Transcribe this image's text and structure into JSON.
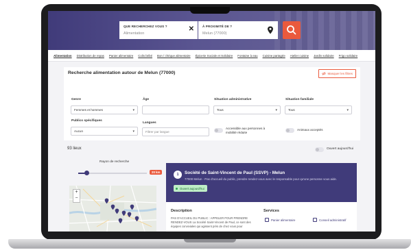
{
  "search": {
    "what_label": "QUE RECHERCHEZ VOUS ?",
    "what_value": "Alimentation",
    "where_label": "À PROXIMITÉ DE ?",
    "where_value": "Melun (77000)"
  },
  "categories": [
    "Alimentation",
    "Distribution de repas",
    "Panier alimentaire",
    "Colis bébé",
    "Bon / chèque alimentaire",
    "Épicerie Sociale et Solidaire",
    "Fontaine à eau",
    "Cuisine partagée",
    "Atelier cuisine",
    "Jardin solidaire",
    "Frigo solidaire"
  ],
  "filters": {
    "title": "Recherche alimentation autour de Melun (77000)",
    "hide_label": "Masquer les filtres",
    "genre_label": "Genre",
    "genre_value": "Femmes et hommes",
    "age_label": "Âge",
    "situation_admin_label": "Situation administrative",
    "situation_admin_value": "Tous",
    "situation_familiale_label": "Situation familiale",
    "situation_familiale_value": "Tous",
    "publics_label": "Publics spécifiques",
    "publics_value": "Aucun",
    "langues_label": "Langues",
    "langues_placeholder": "Filtrer par langue",
    "accessible_label_1": "Accessible aux personnes à",
    "accessible_label_2": "mobilité réduite",
    "animaux_label": "Animaux acceptés"
  },
  "results": {
    "count": "93 lieux",
    "open_today_label": "Ouvert aujourd'hui",
    "radius_label": "Rayon de recherche",
    "radius_value": "20 km"
  },
  "card": {
    "number": "1",
    "title": "Société de Saint-Vincent de Paul (SSVP) - Melun",
    "subtitle": "77000 Melun · Pas d'accueil du public, prendre rendez-vous avec le responsable pour qu'une personne vous aide.",
    "open_badge": "Ouvert aujourd'hui",
    "description_title": "Description",
    "description_lines": [
      "PAS D'ACCUEIL DU PUBLIC : APPELER POUR PRENDRE",
      "RENDEZ-VOUS La Société Saint-Vincent de Paul, ce sont des",
      "équipes conviviales qui agissent près de chez vous pour"
    ],
    "services_title": "Services",
    "services": [
      "Panier alimentaire",
      "Conseil administratif"
    ]
  },
  "colors": {
    "brand_purple": "#403b7a",
    "accent_orange": "#ea5a3d",
    "open_green": "#bfeec7"
  },
  "icons": [
    "close-icon",
    "map-pin-icon",
    "search-icon",
    "eye-off-icon",
    "chevron-down-icon",
    "basket-icon",
    "document-icon"
  ]
}
